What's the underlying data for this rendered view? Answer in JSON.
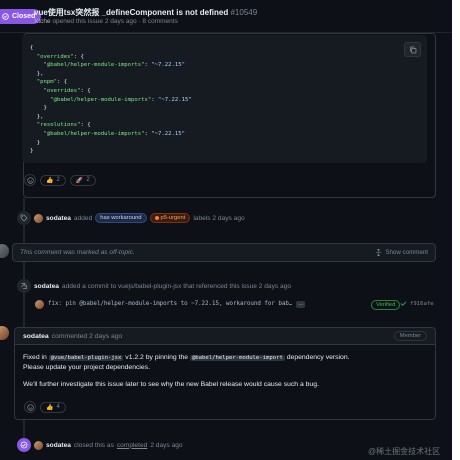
{
  "header": {
    "status": "Closed",
    "title": "vue使用tsx突然报 _defineComponent is not defined",
    "number": "#10549",
    "author": "Xtche",
    "opened_text": "opened this issue 2 days ago · 8 comments"
  },
  "code_block": {
    "lines": [
      "{",
      "  \"overrides\": {",
      "    \"@babel/helper-module-imports\": \"~7.22.15\"",
      "  },",
      "  \"pnpm\": {",
      "    \"overrides\": {",
      "      \"@babel/helper-module-imports\": \"~7.22.15\"",
      "    }",
      "  },",
      "  \"resolutions\": {",
      "    \"@babel/helper-module-imports\": \"~7.22.15\"",
      "  }",
      "}"
    ]
  },
  "reactions_1": [
    {
      "emoji": "👍",
      "count": "2"
    },
    {
      "emoji": "🚀",
      "count": "2"
    }
  ],
  "label_event": {
    "user": "sodatea",
    "action": "added",
    "labels": [
      "has workaround",
      "p5-urgent"
    ],
    "suffix": "labels 2 days ago"
  },
  "offtopic": {
    "text": "This comment was marked as off-topic.",
    "show": "Show comment"
  },
  "commit_event": {
    "user": "sodatea",
    "text": "added a commit to vuejs/babel-plugin-jsx that referenced this issue 2 days ago",
    "message": "fix: pin @babel/helper-module-imports to ~7.22.15, workaround for bab…",
    "more": "…",
    "verified": "Verified",
    "sha": "f916afe"
  },
  "comment_2": {
    "user": "sodatea",
    "meta": "commented 2 days ago",
    "role": "Member",
    "p1_a": "Fixed in ",
    "p1_code1": "@vue/babel-plugin-jsx",
    "p1_b": " v1.2.2 by pinning the ",
    "p1_code2": "@babel/helper-module-import",
    "p1_c": " dependency version.",
    "p2": "Please update your project dependencies.",
    "p3": "We'll further investigate this issue later to see why the new Babel release would cause such a bug.",
    "reaction": {
      "emoji": "👍",
      "count": "4"
    }
  },
  "closed_event": {
    "user": "sodatea",
    "a": "closed this as",
    "link": "completed",
    "b": "2 days ago"
  },
  "watermark": "@稀土掘金技术社区",
  "colors": {
    "closed_purple": "#8957e5",
    "bg": "#0d1117",
    "verified_green": "#3fb950"
  }
}
